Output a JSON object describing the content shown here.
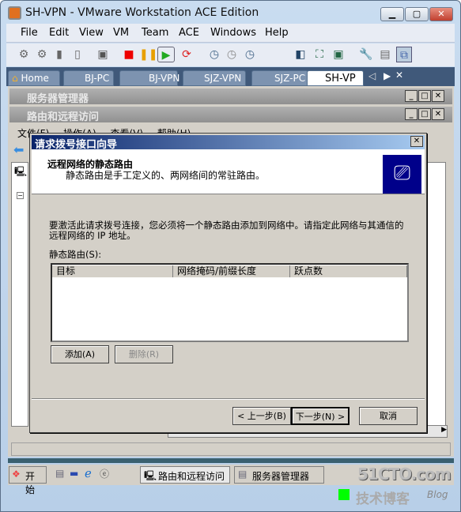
{
  "window": {
    "title": "SH-VPN - VMware Workstation ACE Edition",
    "minimize": "▁",
    "maximize": "▢",
    "close": "✕"
  },
  "menu": [
    "File",
    "Edit",
    "View",
    "VM",
    "Team",
    "ACE",
    "Windows",
    "Help"
  ],
  "tabs": [
    "Home",
    "BJ-PC",
    "BJ-VPN",
    "SJZ-VPN",
    "SJZ-PC",
    "SH-VP"
  ],
  "guest": {
    "server_manager_title": "服务器管理器",
    "rras_title": "路由和远程访问",
    "rras_menu": [
      "文件(F)",
      "操作(A)",
      "查看(V)",
      "帮助(H)"
    ],
    "taskbar": {
      "start": "开始",
      "tasks": [
        "路由和远程访问",
        "服务器管理器"
      ]
    }
  },
  "dialog": {
    "title": "请求拨号接口向导",
    "heading": "远程网络的静态路由",
    "subheading": "静态路由是手工定义的、两网络间的常驻路由。",
    "description": "要激活此请求拨号连接，您必须将一个静态路由添加到网络中。请指定此网络与其通信的远程网络的 IP 地址。",
    "list_label": "静态路由(S):",
    "columns": [
      "目标",
      "网络掩码/前缀长度",
      "跃点数"
    ],
    "add": "添加(A)",
    "delete": "删除(R)",
    "back": "< 上一步(B)",
    "next": "下一步(N) >",
    "cancel": "取消",
    "close": "✕"
  },
  "watermark": {
    "site": "51CTO.com",
    "sub": "技术博客",
    "blog": "Blog"
  },
  "colors": {
    "dialog_title_start": "#0a246a",
    "dialog_title_end": "#a6caf0",
    "tabbar": "#40597a",
    "face": "#d4d0c8"
  }
}
